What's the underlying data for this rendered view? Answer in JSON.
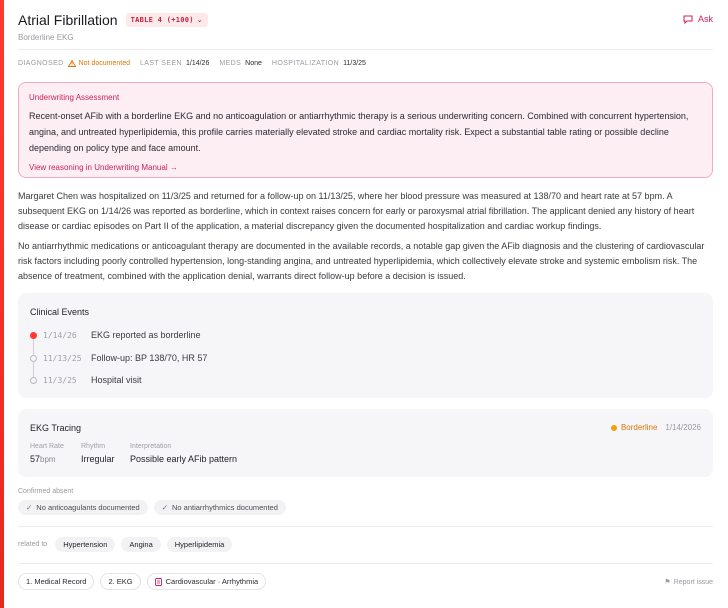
{
  "header": {
    "title": "Atrial Fibrillation",
    "table_badge": "TABLE 4 (+100)",
    "subtitle": "Borderline EKG",
    "ask_label": "Ask"
  },
  "meta": {
    "diagnosed_label": "DIAGNOSED",
    "diagnosed_value": "Not documented",
    "last_seen_label": "LAST SEEN",
    "last_seen_value": "1/14/26",
    "meds_label": "MEDS",
    "meds_value": "None",
    "hosp_label": "HOSPITALIZATION",
    "hosp_value": "11/3/25"
  },
  "underwriting": {
    "title": "Underwriting Assessment",
    "body": "Recent-onset AFib with a borderline EKG and no anticoagulation or antiarrhythmic therapy is a serious underwriting concern. Combined with concurrent hypertension, angina, and untreated hyperlipidemia, this profile carries materially elevated stroke and cardiac mortality risk. Expect a substantial table rating or possible decline depending on policy type and face amount.",
    "link": "View reasoning in Underwriting Manual →"
  },
  "paragraphs": [
    "Margaret Chen was hospitalized on 11/3/25 and returned for a follow-up on 11/13/25, where her blood pressure was measured at 138/70 and heart rate at 57 bpm. A subsequent EKG on 1/14/26 was reported as borderline, which in context raises concern for early or paroxysmal atrial fibrillation. The applicant denied any history of heart disease or cardiac episodes on Part II of the application, a material discrepancy given the documented hospitalization and cardiac workup findings.",
    "No antiarrhythmic medications or anticoagulant therapy are documented in the available records, a notable gap given the AFib diagnosis and the clustering of cardiovascular risk factors including poorly controlled hypertension, long-standing angina, and untreated hyperlipidemia, which collectively elevate stroke and systemic embolism risk. The absence of treatment, combined with the application denial, warrants direct follow-up before a decision is issued."
  ],
  "clinical_events": {
    "title": "Clinical Events",
    "events": [
      {
        "date": "1/14/26",
        "text": "EKG reported as borderline"
      },
      {
        "date": "11/13/25",
        "text": "Follow-up: BP 138/70, HR 57"
      },
      {
        "date": "11/3/25",
        "text": "Hospital visit"
      }
    ]
  },
  "ekg": {
    "title": "EKG Tracing",
    "status": "Borderline",
    "date": "1/14/2026",
    "heart_rate_label": "Heart Rate",
    "heart_rate_value": "57",
    "heart_rate_unit": "bpm",
    "rhythm_label": "Rhythm",
    "rhythm_value": "Irregular",
    "interp_label": "Interpretation",
    "interp_value": "Possible early AFib pattern"
  },
  "confirmed_absent": {
    "label": "Confirmed absent",
    "items": [
      "No anticoagulants documented",
      "No antiarrhythmics documented"
    ]
  },
  "related": {
    "label": "related to",
    "items": [
      "Hypertension",
      "Angina",
      "Hyperlipidemia"
    ]
  },
  "sources": [
    "1. Medical Record",
    "2. EKG",
    "Cardiovascular · Arrhythmia"
  ],
  "report_label": "Report issue",
  "colors": {
    "accent": "#ff3b30",
    "brand_pink": "#d21e58",
    "warning": "#d97706"
  }
}
